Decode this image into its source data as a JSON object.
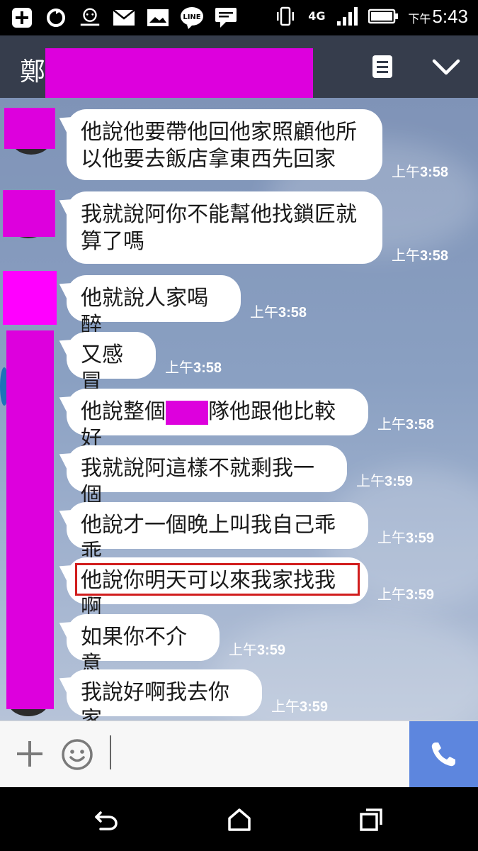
{
  "status_bar": {
    "time_prefix": "下午",
    "time": "5:43",
    "network": "4G",
    "icons": [
      "plus-icon",
      "sync-icon",
      "gomaji-icon",
      "mail-icon",
      "image-icon",
      "line-icon",
      "chat-icon",
      "vibrate-icon",
      "signal-icon",
      "battery-icon"
    ]
  },
  "header": {
    "title": "鄭",
    "menu_icon": "menu-icon",
    "collapse_icon": "chevron-down-icon"
  },
  "messages": [
    {
      "lines": [
        "他說他要帶他回他家照顧他所",
        "以他要去飯店拿東西先回家"
      ],
      "prefix": "上午",
      "time": "3:58"
    },
    {
      "lines": [
        "我就說阿你不能幫他找鎖匠就",
        "算了嗎"
      ],
      "prefix": "上午",
      "time": "3:58"
    },
    {
      "lines": [
        "他就說人家喝醉"
      ],
      "prefix": "上午",
      "time": "3:58"
    },
    {
      "lines": [
        "又感冒"
      ],
      "prefix": "上午",
      "time": "3:58"
    },
    {
      "before": "他說整個",
      "after": "隊他跟他比較好",
      "prefix": "上午",
      "time": "3:58"
    },
    {
      "lines": [
        "我就說阿這樣不就剩我一個"
      ],
      "prefix": "上午",
      "time": "3:59"
    },
    {
      "lines": [
        "他說才一個晚上叫我自己乖乖"
      ],
      "prefix": "上午",
      "time": "3:59"
    },
    {
      "lines": [
        "他說你明天可以來我家找我啊"
      ],
      "prefix": "上午",
      "time": "3:59",
      "highlighted": true
    },
    {
      "lines": [
        "如果你不介意"
      ],
      "prefix": "上午",
      "time": "3:59"
    },
    {
      "lines": [
        "我說好啊我去你家"
      ],
      "prefix": "上午",
      "time": "3:59"
    }
  ],
  "input_bar": {
    "plus_icon": "plus-icon",
    "emoji_icon": "emoji-icon",
    "call_icon": "phone-icon"
  },
  "nav_bar": {
    "icons": [
      "back-icon",
      "home-icon",
      "recent-apps-icon"
    ]
  },
  "colors": {
    "header_bg": "#363d4c",
    "chat_bg": "#8aa0c2",
    "redaction": "#dd00dd",
    "call_button": "#5d86de",
    "highlight_border": "#d11d1d"
  }
}
